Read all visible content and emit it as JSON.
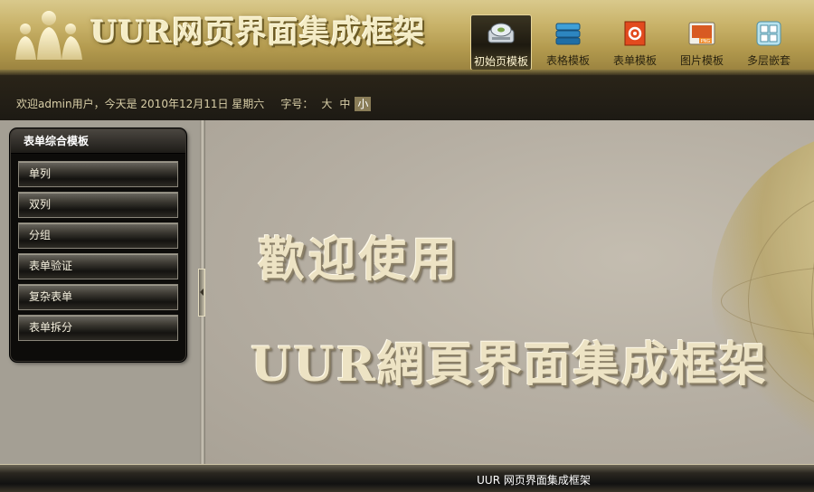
{
  "header": {
    "logo_text": "UUR网页界面集成框架",
    "nav": [
      {
        "label": "初始页模板",
        "icon": "disk-drive-icon",
        "active": true
      },
      {
        "label": "表格模板",
        "icon": "stacked-books-icon",
        "active": false
      },
      {
        "label": "表单模板",
        "icon": "form-gear-icon",
        "active": false
      },
      {
        "label": "图片模板",
        "icon": "png-image-icon",
        "active": false
      },
      {
        "label": "多层嵌套",
        "icon": "window-grid-icon",
        "active": false
      }
    ]
  },
  "infobar": {
    "welcome": "欢迎admin用户，今天是 2010年12月11日 星期六",
    "fontsize_label": "字号：",
    "sizes": [
      "大",
      "中",
      "小"
    ],
    "selected_size": "小"
  },
  "sidebar": {
    "title": "表单综合模板",
    "items": [
      {
        "label": "单列"
      },
      {
        "label": "双列"
      },
      {
        "label": "分组"
      },
      {
        "label": "表单验证"
      },
      {
        "label": "复杂表单"
      },
      {
        "label": "表单拆分"
      }
    ]
  },
  "main": {
    "welcome_line1": "歡迎使用",
    "welcome_line2": "UUR網頁界面集成框架"
  },
  "footer": {
    "text": "UUR 网页界面集成框架"
  },
  "colors": {
    "header_gold": "#c9b36a",
    "panel_dark": "#0d0c0a",
    "content_gray": "#b7b0a4"
  }
}
